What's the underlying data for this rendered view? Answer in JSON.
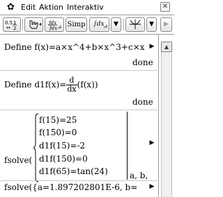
{
  "menu": {
    "gear_icon": "gear-icon",
    "items": [
      "Edit",
      "Aktion",
      "Interaktiv"
    ],
    "close_label": "✕"
  },
  "toolbar": {
    "fraction_label": "0.5↔½",
    "cursor_label": "☝",
    "d_dx_label": "∫dx→",
    "simp_label": "Simp",
    "integral_label": "∫dx",
    "dropdown_label": "▼",
    "graph_label": "⟂",
    "next_label": "▶"
  },
  "work": {
    "line1": "Define  f(x)=a×x^4+b×x^3+c×x",
    "line1_result": "done",
    "line2_prefix": "Define  d1f(x)=",
    "line2_frac_num": "d",
    "line2_frac_den": "dx",
    "line2_suffix": "(f(x))",
    "line2_result": "done",
    "solve_label": "fsolve(",
    "equations": [
      "f(15)=25",
      "f(150)=0",
      "d1f(15)=-2",
      "d1f(150)=0",
      "d1f(65)=tan(24)"
    ],
    "solve_vars": "a, b,",
    "result_line": "fsolve({a=1.897202801E-6, b="
  },
  "scrollbar": {
    "up_arrow": "▲"
  }
}
